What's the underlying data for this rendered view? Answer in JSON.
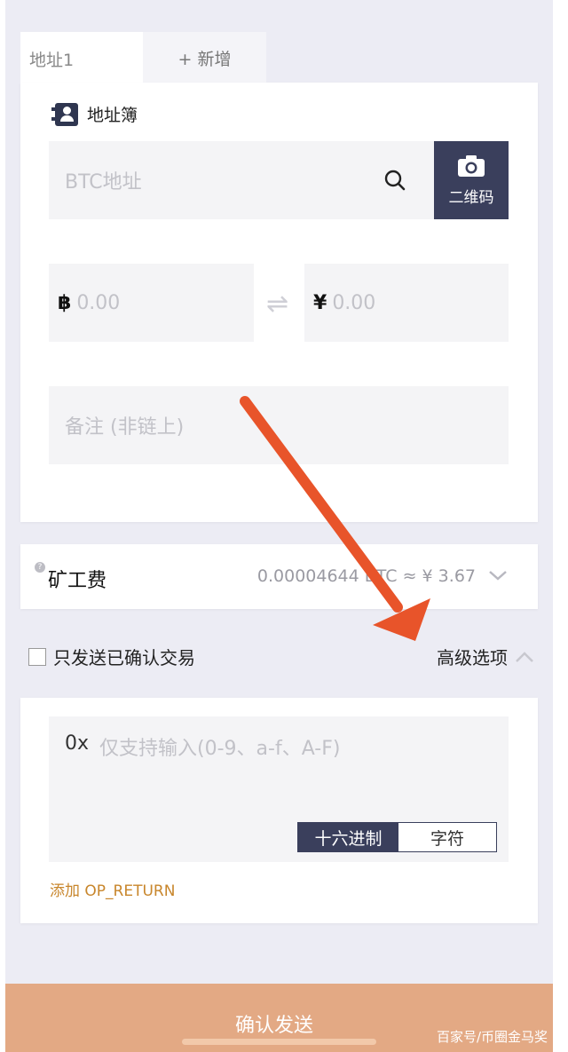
{
  "tabs": [
    {
      "label": "地址1"
    },
    {
      "label": "+ 新增"
    }
  ],
  "address_book": {
    "label": "地址簿",
    "icon": "contacts-book-icon"
  },
  "address_input": {
    "placeholder": "BTC地址",
    "search_icon": "search-icon"
  },
  "qr_button": {
    "label": "二维码",
    "icon": "camera-icon"
  },
  "amount": {
    "btc_symbol": "฿",
    "btc_value": "0.00",
    "swap_icon": "swap-arrows-icon",
    "cny_symbol": "¥",
    "cny_value": "0.00"
  },
  "memo": {
    "placeholder": "备注 (非链上)"
  },
  "fee": {
    "help_icon": "?",
    "label": "矿工费",
    "value": "0.00004644 BTC ≈ ¥ 3.67",
    "chevron": "chevron-down-icon"
  },
  "options": {
    "only_confirmed_label": "只发送已确认交易",
    "only_confirmed_checked": false,
    "advanced_label": "高级选项",
    "advanced_expanded": true
  },
  "advanced_panel": {
    "hex_prefix": "0x",
    "hex_placeholder": "仅支持输入(0-9、a-f、A-F)",
    "mode_options": [
      "十六进制",
      "字符"
    ],
    "mode_selected": "十六进制",
    "op_return_link": "添加 OP_RETURN"
  },
  "confirm_button": {
    "label": "确认发送"
  },
  "watermark": "百家号/币圈金马奖",
  "colors": {
    "dark_navy": "#3a3f5c",
    "confirm_orange": "#e3a984",
    "link_orange": "#c8862c",
    "annotation_arrow": "#e8542a",
    "background": "#ececf4"
  }
}
